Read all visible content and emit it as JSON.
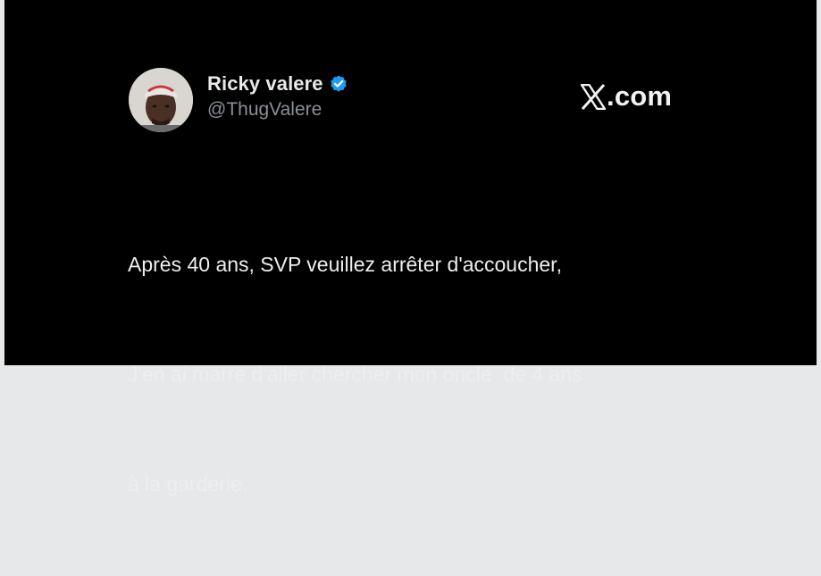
{
  "author": {
    "display_name": "Ricky valere",
    "handle": "@ThugValere",
    "verified": true,
    "avatar_icon": "profile-photo"
  },
  "brand": {
    "icon": "x-logo-icon",
    "text": ".com"
  },
  "tweet": {
    "lines": [
      "Après 40 ans, SVP veuillez arrêter d'accoucher,",
      "J'en ai marre d'aller chercher mon oncle  de 4 ans",
      "à la garderie."
    ]
  },
  "colors": {
    "background": "#000000",
    "verified_badge": "#1d9bf0",
    "handle": "#8b9096"
  }
}
